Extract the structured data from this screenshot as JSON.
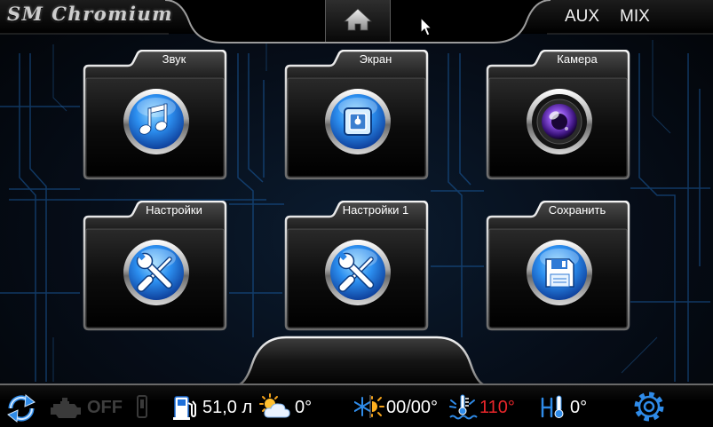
{
  "brand": {
    "logo_text": "SM Chromium"
  },
  "top_bar": {
    "home_icon": "home-icon",
    "aux_label": "AUX",
    "mix_label": "MIX"
  },
  "tiles": [
    {
      "label": "Звук",
      "icon": "music-note-icon"
    },
    {
      "label": "Экран",
      "icon": "screen-icon"
    },
    {
      "label": "Камера",
      "icon": "camera-lens-icon"
    },
    {
      "label": "Настройки",
      "icon": "tools-icon"
    },
    {
      "label": "Настройки 1",
      "icon": "tools-icon"
    },
    {
      "label": "Сохранить",
      "icon": "floppy-disk-icon"
    }
  ],
  "status_bar": {
    "refresh_icon": "refresh-icon",
    "engine_icon": "engine-icon",
    "engine_state": "OFF",
    "phone_icon": "phone-icon",
    "fuel_icon": "fuel-pump-icon",
    "fuel_level": "51,0 л",
    "weather_icon": "sun-cloud-icon",
    "outside_temp": "0°",
    "climate_icon": "snowflake-sun-icon",
    "climate_temps": "00/00°",
    "coolant_icon": "coolant-temp-icon",
    "coolant_temp": "110°",
    "cabin_icon": "cabin-temp-icon",
    "cabin_temp": "0°",
    "settings_icon": "gear-icon"
  },
  "colors": {
    "accent_blue": "#2f8be8",
    "warning_red": "#e8262a",
    "inactive_gray": "#3e3e3e"
  }
}
